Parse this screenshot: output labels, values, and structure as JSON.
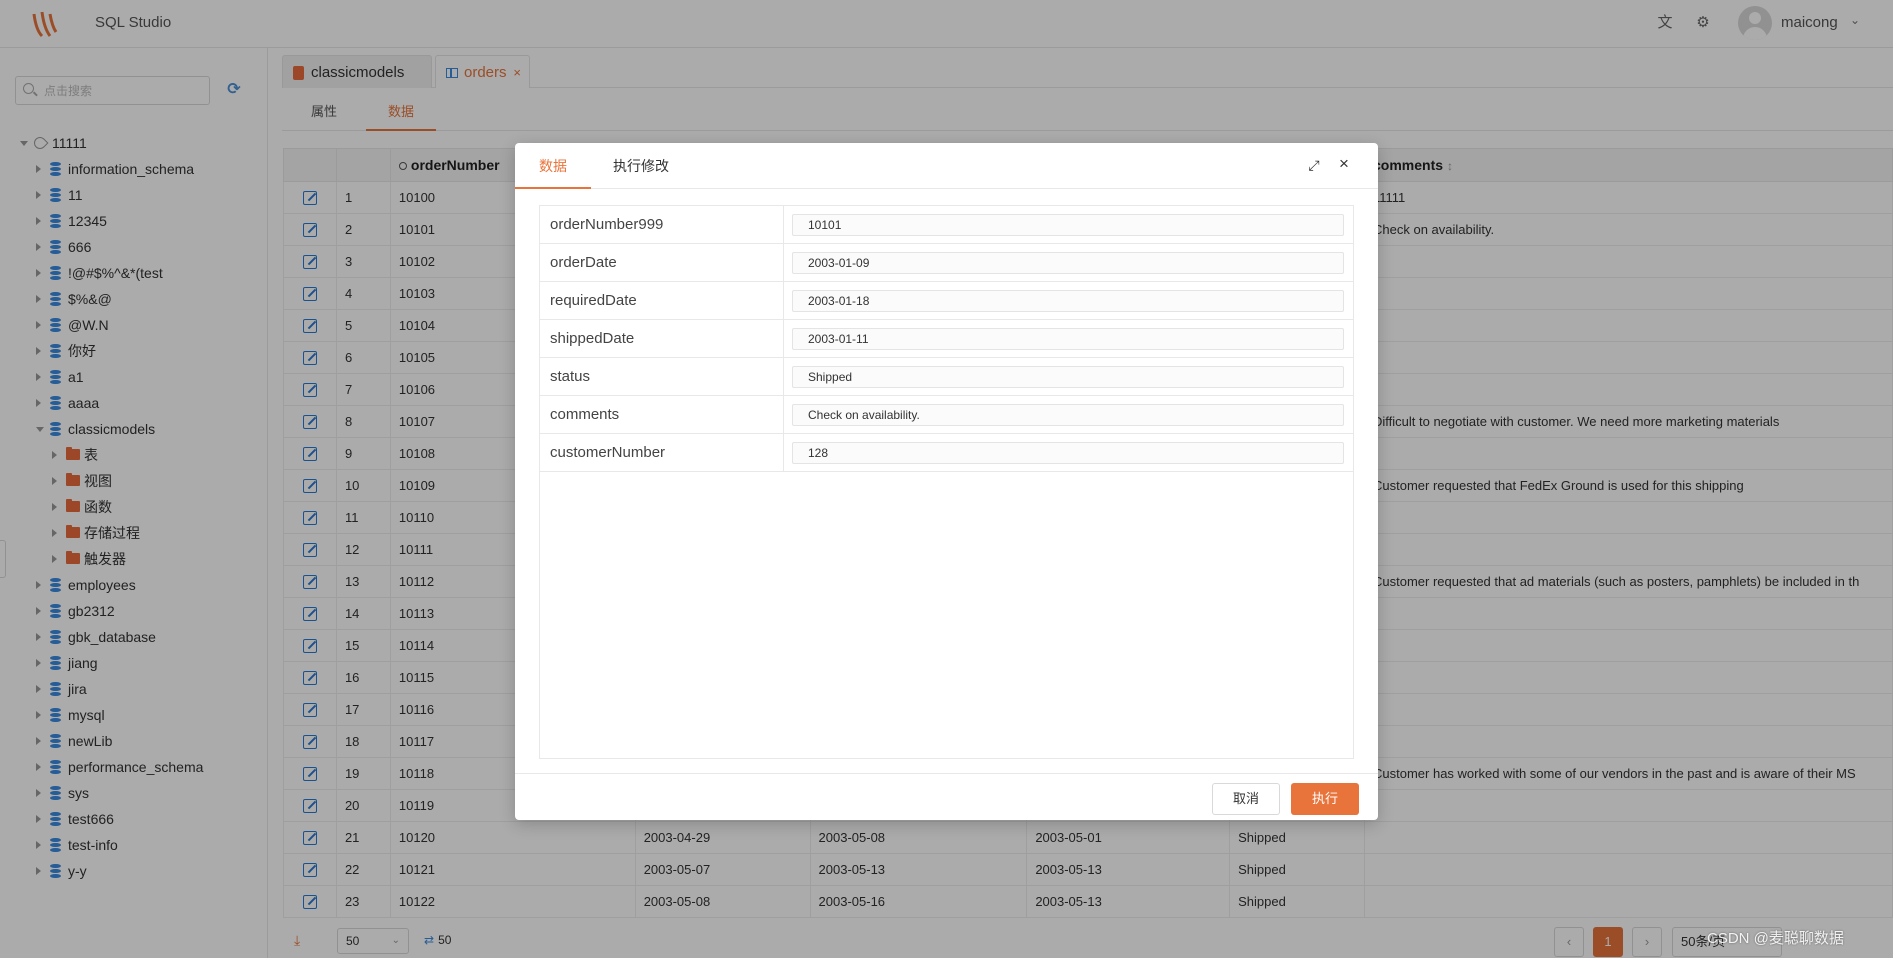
{
  "header": {
    "app_title": "SQL Studio",
    "username": "maicong",
    "icons": [
      "translate-icon",
      "settings-icon"
    ]
  },
  "sidebar": {
    "search_placeholder": "点击搜索",
    "tree": [
      {
        "label": "11111",
        "level": 0,
        "type": "connection",
        "open": true
      },
      {
        "label": "information_schema",
        "level": 1,
        "type": "db"
      },
      {
        "label": "11",
        "level": 1,
        "type": "db"
      },
      {
        "label": "12345",
        "level": 1,
        "type": "db"
      },
      {
        "label": "666",
        "level": 1,
        "type": "db"
      },
      {
        "label": "!@#$%^&*(test",
        "level": 1,
        "type": "db"
      },
      {
        "label": "$%&@",
        "level": 1,
        "type": "db"
      },
      {
        "label": "@W.N",
        "level": 1,
        "type": "db"
      },
      {
        "label": "你好",
        "level": 1,
        "type": "db"
      },
      {
        "label": "a1",
        "level": 1,
        "type": "db"
      },
      {
        "label": "aaaa",
        "level": 1,
        "type": "db"
      },
      {
        "label": "classicmodels",
        "level": 1,
        "type": "db",
        "open": true
      },
      {
        "label": "表",
        "level": 2,
        "type": "folder"
      },
      {
        "label": "视图",
        "level": 2,
        "type": "folder"
      },
      {
        "label": "函数",
        "level": 2,
        "type": "folder"
      },
      {
        "label": "存储过程",
        "level": 2,
        "type": "folder"
      },
      {
        "label": "触发器",
        "level": 2,
        "type": "folder"
      },
      {
        "label": "employees",
        "level": 1,
        "type": "db"
      },
      {
        "label": "gb2312",
        "level": 1,
        "type": "db"
      },
      {
        "label": "gbk_database",
        "level": 1,
        "type": "db"
      },
      {
        "label": "jiang",
        "level": 1,
        "type": "db"
      },
      {
        "label": "jira",
        "level": 1,
        "type": "db"
      },
      {
        "label": "mysql",
        "level": 1,
        "type": "db"
      },
      {
        "label": "newLib",
        "level": 1,
        "type": "db"
      },
      {
        "label": "performance_schema",
        "level": 1,
        "type": "db"
      },
      {
        "label": "sys",
        "level": 1,
        "type": "db"
      },
      {
        "label": "test666",
        "level": 1,
        "type": "db"
      },
      {
        "label": "test-info",
        "level": 1,
        "type": "db"
      },
      {
        "label": "y-y",
        "level": 1,
        "type": "db"
      }
    ]
  },
  "tabs": [
    {
      "label": "classicmodels",
      "icon": "database-icon"
    },
    {
      "label": "orders",
      "icon": "table-icon",
      "close": "×"
    }
  ],
  "subtabs": [
    "属性",
    "数据"
  ],
  "grid": {
    "headers": [
      "",
      "",
      "orderNumber",
      "",
      "",
      "",
      "",
      "comments"
    ],
    "rows": [
      [
        "1",
        "10100",
        "",
        "",
        "",
        "",
        "11111"
      ],
      [
        "2",
        "10101",
        "",
        "",
        "",
        "",
        "Check on availability."
      ],
      [
        "3",
        "10102",
        "",
        "",
        "",
        "",
        ""
      ],
      [
        "4",
        "10103",
        "",
        "",
        "",
        "",
        ""
      ],
      [
        "5",
        "10104",
        "",
        "",
        "",
        "",
        ""
      ],
      [
        "6",
        "10105",
        "",
        "",
        "",
        "",
        ""
      ],
      [
        "7",
        "10106",
        "",
        "",
        "",
        "",
        ""
      ],
      [
        "8",
        "10107",
        "",
        "",
        "",
        "",
        "Difficult to negotiate with customer. We need more marketing materials"
      ],
      [
        "9",
        "10108",
        "",
        "",
        "",
        "",
        ""
      ],
      [
        "10",
        "10109",
        "",
        "",
        "",
        "",
        "Customer requested that FedEx Ground is used for this shipping"
      ],
      [
        "11",
        "10110",
        "",
        "",
        "",
        "",
        ""
      ],
      [
        "12",
        "10111",
        "",
        "",
        "",
        "",
        ""
      ],
      [
        "13",
        "10112",
        "",
        "",
        "",
        "",
        "Customer requested that ad materials (such as posters, pamphlets) be included in th"
      ],
      [
        "14",
        "10113",
        "",
        "",
        "",
        "",
        ""
      ],
      [
        "15",
        "10114",
        "",
        "",
        "",
        "",
        ""
      ],
      [
        "16",
        "10115",
        "",
        "",
        "",
        "",
        ""
      ],
      [
        "17",
        "10116",
        "",
        "",
        "",
        "",
        ""
      ],
      [
        "18",
        "10117",
        "",
        "",
        "",
        "",
        ""
      ],
      [
        "19",
        "10118",
        "",
        "",
        "",
        "",
        "Customer has worked with some of our vendors in the past and is aware of their MS"
      ],
      [
        "20",
        "10119",
        "",
        "",
        "",
        "",
        ""
      ],
      [
        "21",
        "10120",
        "2003-04-29",
        "2003-05-08",
        "2003-05-01",
        "Shipped",
        ""
      ],
      [
        "22",
        "10121",
        "2003-05-07",
        "2003-05-13",
        "2003-05-13",
        "Shipped",
        ""
      ],
      [
        "23",
        "10122",
        "2003-05-08",
        "2003-05-16",
        "2003-05-13",
        "Shipped",
        ""
      ]
    ]
  },
  "footer": {
    "page_size": "50",
    "count": "50",
    "current_page": "1",
    "page_size_label": "50条/页"
  },
  "modal": {
    "tabs": [
      "数据",
      "执行修改"
    ],
    "fields": [
      {
        "label": "orderNumber999",
        "value": "10101"
      },
      {
        "label": "orderDate",
        "value": "2003-01-09"
      },
      {
        "label": "requiredDate",
        "value": "2003-01-18"
      },
      {
        "label": "shippedDate",
        "value": "2003-01-11"
      },
      {
        "label": "status",
        "value": "Shipped"
      },
      {
        "label": "comments",
        "value": "Check on availability."
      },
      {
        "label": "customerNumber",
        "value": "128"
      }
    ],
    "cancel_label": "取消",
    "exec_label": "执行"
  },
  "watermark": "CSDN @麦聪聊数据",
  "colors": {
    "accent": "#e8743b",
    "db_icon": "#3b8be0"
  }
}
